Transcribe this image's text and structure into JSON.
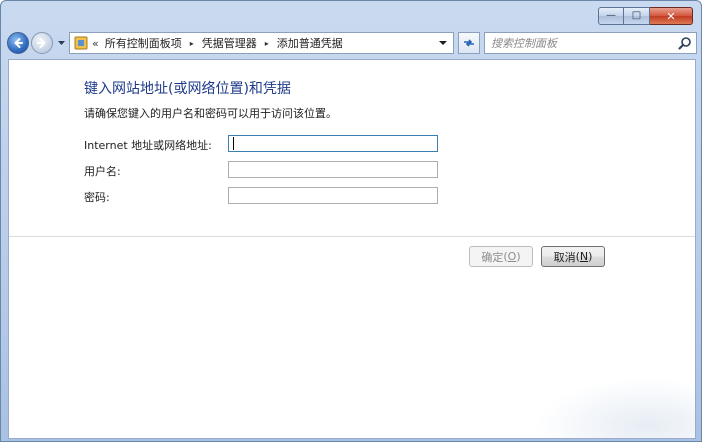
{
  "window": {
    "caption": {
      "minimize_glyph": "—",
      "maximize_glyph": "□",
      "close_glyph": "✕"
    }
  },
  "navbar": {
    "back_icon": "back-arrow-icon",
    "forward_icon": "forward-arrow-icon",
    "breadcrumb_prefix": "«",
    "breadcrumbs": [
      "所有控制面板项",
      "凭据管理器",
      "添加普通凭据"
    ],
    "breadcrumb_separator": "▸",
    "refresh_icon": "refresh-icon",
    "search_placeholder": "搜索控制面板",
    "search_icon": "search-icon"
  },
  "main": {
    "heading": "键入网站地址(或网络位置)和凭据",
    "subheading": "请确保您键入的用户名和密码可以用于访问该位置。",
    "fields": [
      {
        "label": "Internet 地址或网络地址:",
        "value": ""
      },
      {
        "label": "用户名:",
        "value": ""
      },
      {
        "label": "密码:",
        "value": ""
      }
    ],
    "ok_button": {
      "label": "确定",
      "mnemonic": "O",
      "enabled": false
    },
    "cancel_button": {
      "label": "取消",
      "mnemonic": "N"
    }
  },
  "colors": {
    "heading": "#1e3a8a",
    "close_button": "#c23b22",
    "frame": "#b7cce8"
  }
}
